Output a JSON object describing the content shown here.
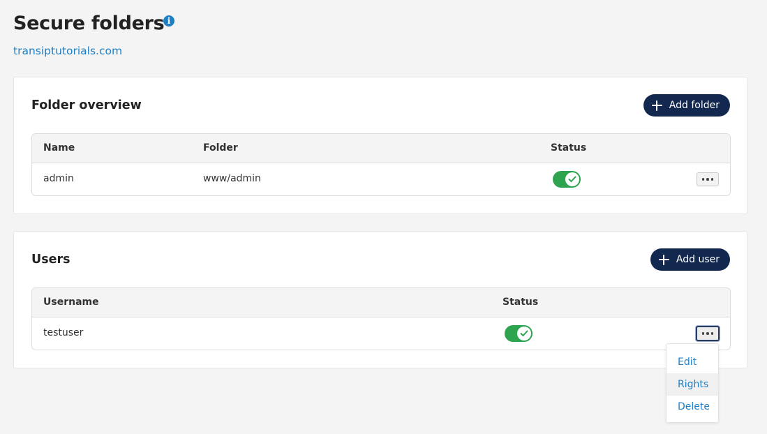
{
  "page": {
    "title": "Secure folders",
    "info_icon": "info-circle-icon",
    "domain": "transiptutorials.com"
  },
  "colors": {
    "background": "#f4f4f4",
    "link": "#1f7fc4",
    "primary_button": "#12284f",
    "toggle_on": "#2ea44f"
  },
  "folders": {
    "title": "Folder overview",
    "add_button": "Add folder",
    "columns": [
      "Name",
      "Folder",
      "Status"
    ],
    "rows": [
      {
        "name": "admin",
        "folder": "www/admin",
        "status": "enabled"
      }
    ]
  },
  "users": {
    "title": "Users",
    "add_button": "Add user",
    "columns": [
      "Username",
      "Status"
    ],
    "rows": [
      {
        "username": "testuser",
        "status": "enabled"
      }
    ]
  },
  "actions_menu": {
    "items": [
      "Edit",
      "Rights",
      "Delete"
    ],
    "highlighted": "Rights"
  }
}
